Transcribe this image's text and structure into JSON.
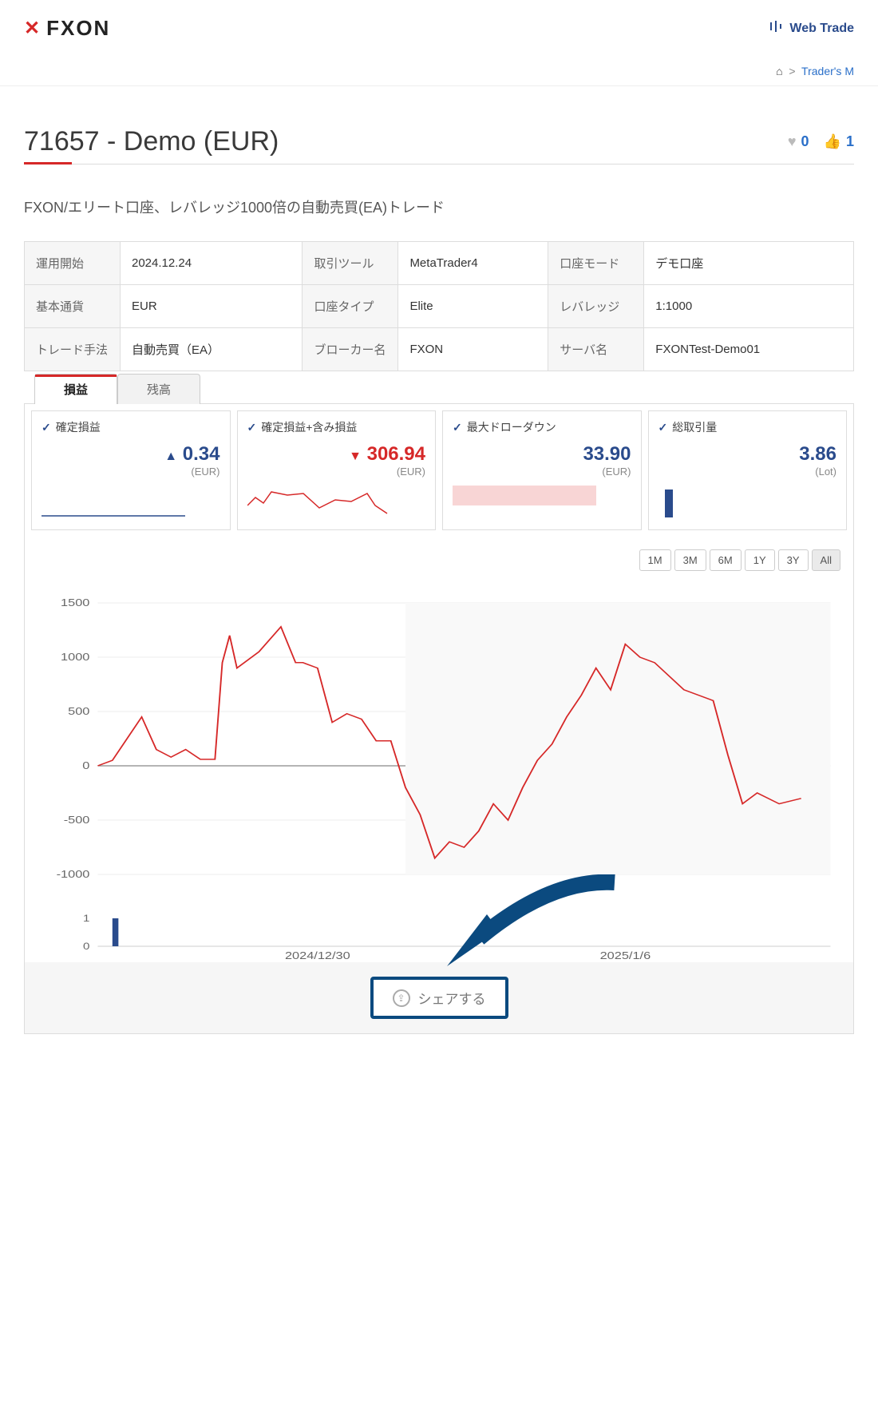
{
  "header": {
    "brand": "FXON",
    "webtrader": "Web Trade"
  },
  "breadcrumb": {
    "current": "Trader's M"
  },
  "page": {
    "title": "71657 - Demo (EUR)",
    "favorites": "0",
    "likes": "1",
    "description": "FXON/エリート口座、レバレッジ1000倍の自動売買(EA)トレード"
  },
  "info": [
    {
      "l1": "運用開始",
      "v1": "2024.12.24",
      "l2": "取引ツール",
      "v2": "MetaTrader4",
      "l3": "口座モード",
      "v3": "デモ口座"
    },
    {
      "l1": "基本通貨",
      "v1": "EUR",
      "l2": "口座タイプ",
      "v2": "Elite",
      "l3": "レバレッジ",
      "v3": "1:1000"
    },
    {
      "l1": "トレード手法",
      "v1": "自動売買（EA）",
      "l2": "ブローカー名",
      "v2": "FXON",
      "l3": "サーバ名",
      "v3": "FXONTest-Demo01"
    }
  ],
  "tabs": {
    "active": "損益",
    "other": "残高"
  },
  "metrics": {
    "confirmed": {
      "label": "確定損益",
      "value": "0.34",
      "dir": "▲",
      "unit": "(EUR)"
    },
    "floating": {
      "label": "確定損益+含み損益",
      "value": "306.94",
      "dir": "▼",
      "unit": "(EUR)"
    },
    "drawdown": {
      "label": "最大ドローダウン",
      "value": "33.90",
      "unit": "(EUR)"
    },
    "volume": {
      "label": "総取引量",
      "value": "3.86",
      "unit": "(Lot)"
    }
  },
  "ranges": [
    "1M",
    "3M",
    "6M",
    "1Y",
    "3Y",
    "All"
  ],
  "range_active": "All",
  "share": "シェアする",
  "chart_data": {
    "type": "line",
    "title": "",
    "xlabel": "",
    "ylabel": "",
    "ylim": [
      -1000,
      1500
    ],
    "yticks": [
      -1000,
      -500,
      0,
      500,
      1000,
      1500
    ],
    "x_tick_labels": [
      "2024/12/30",
      "2025/1/6"
    ],
    "x_threshold_2025": 42,
    "series": [
      {
        "name": "確定損益+含み損益",
        "color": "#d62828",
        "points": [
          [
            0,
            0
          ],
          [
            2,
            50
          ],
          [
            4,
            250
          ],
          [
            6,
            450
          ],
          [
            8,
            150
          ],
          [
            10,
            80
          ],
          [
            12,
            150
          ],
          [
            14,
            60
          ],
          [
            16,
            60
          ],
          [
            17,
            950
          ],
          [
            18,
            1200
          ],
          [
            19,
            900
          ],
          [
            22,
            1050
          ],
          [
            25,
            1280
          ],
          [
            27,
            950
          ],
          [
            28,
            950
          ],
          [
            30,
            900
          ],
          [
            32,
            400
          ],
          [
            34,
            480
          ],
          [
            36,
            430
          ],
          [
            38,
            230
          ],
          [
            40,
            230
          ],
          [
            42,
            -200
          ],
          [
            44,
            -450
          ],
          [
            46,
            -850
          ],
          [
            48,
            -700
          ],
          [
            50,
            -750
          ],
          [
            52,
            -600
          ],
          [
            54,
            -350
          ],
          [
            56,
            -500
          ],
          [
            58,
            -200
          ],
          [
            60,
            50
          ],
          [
            62,
            200
          ],
          [
            64,
            450
          ],
          [
            66,
            650
          ],
          [
            68,
            900
          ],
          [
            70,
            700
          ],
          [
            72,
            1120
          ],
          [
            74,
            1000
          ],
          [
            76,
            950
          ],
          [
            80,
            700
          ],
          [
            84,
            600
          ],
          [
            86,
            100
          ],
          [
            88,
            -350
          ],
          [
            90,
            -250
          ],
          [
            93,
            -350
          ],
          [
            96,
            -300
          ]
        ]
      }
    ],
    "mini": {
      "yticks": [
        0,
        1
      ],
      "x_tick_labels": [
        "2024/12/30",
        "2025/1/6"
      ],
      "bar_x": 2,
      "bar_h": 1
    }
  }
}
